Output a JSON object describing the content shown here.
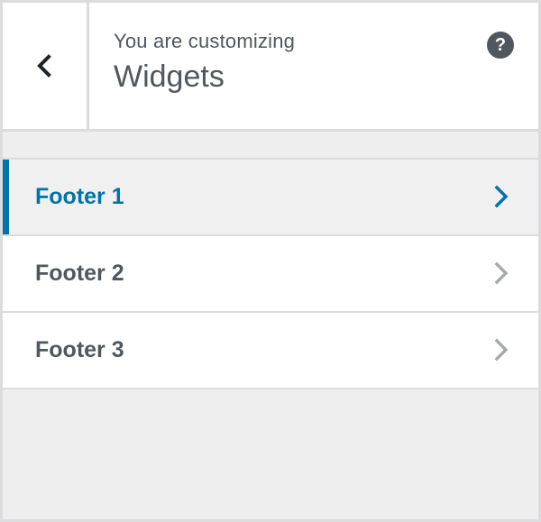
{
  "header": {
    "action_text": "You are customizing",
    "title": "Widgets",
    "back_icon": "chevron-left-icon",
    "help_icon": "help-icon",
    "help_symbol": "?"
  },
  "sections": [
    {
      "label": "Footer 1",
      "active": true
    },
    {
      "label": "Footer 2",
      "active": false
    },
    {
      "label": "Footer 3",
      "active": false
    }
  ],
  "colors": {
    "accent": "#0073aa",
    "text": "#50575e",
    "chevron_inactive": "#a7aaad",
    "border": "#dcdcde",
    "panel_bg": "#eeeeee"
  }
}
